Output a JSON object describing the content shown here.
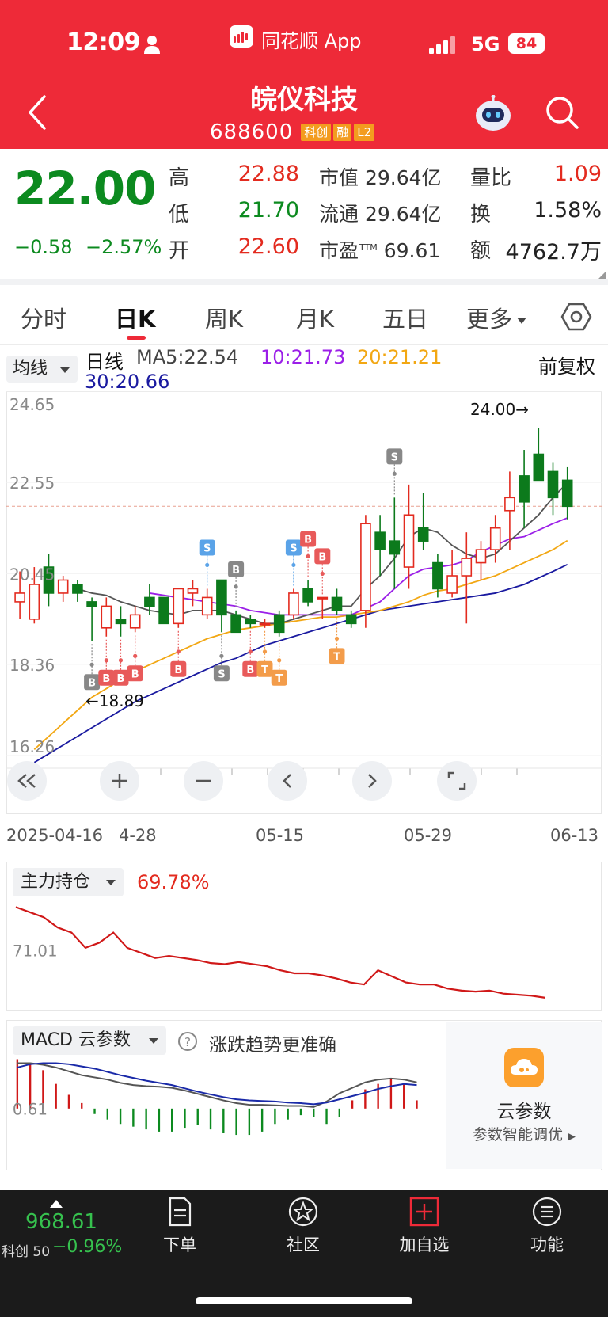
{
  "status_bar": {
    "time": "12:09",
    "network": "5G",
    "battery": "84"
  },
  "app": {
    "name": "同花顺 App"
  },
  "stock": {
    "name": "皖仪科技",
    "code": "688600",
    "tags": [
      "科创",
      "融",
      "L2"
    ]
  },
  "quote": {
    "price": "22.00",
    "change": "−0.58",
    "change_pct": "−2.57%",
    "high_label": "高",
    "high": "22.88",
    "low_label": "低",
    "low": "21.70",
    "open_label": "开",
    "open": "22.60",
    "mcap": "市值 29.64亿",
    "float": "流通 29.64亿",
    "pe_label": "市盈",
    "pe_sup": "TTM",
    "pe_value": "69.61",
    "vol_ratio_label": "量比",
    "vol_ratio": "1.09",
    "turnover_label": "换",
    "turnover": "1.58%",
    "amount_label": "额",
    "amount": "4762.7万"
  },
  "tabs": [
    "分时",
    "日K",
    "周K",
    "月K",
    "五日",
    "更多"
  ],
  "active_tab": "日K",
  "ma_legend": {
    "toggle": "均线",
    "period": "日线",
    "ma5": "MA5:22.54",
    "ma10": "10:21.73",
    "ma20": "20:21.21",
    "ma30": "30:20.66",
    "adjust": "前复权",
    "colors": {
      "ma5": "#555555",
      "ma10": "#9b1fe8",
      "ma20": "#f2a713",
      "ma30": "#1a1aa0"
    }
  },
  "chart_data": {
    "type": "candlestick",
    "y_ticks": [
      "24.65",
      "22.55",
      "20.45",
      "18.36",
      "16.26"
    ],
    "ylim": [
      16.26,
      24.65
    ],
    "x_labels": [
      "2025-04-16",
      "4-28",
      "05-15",
      "05-29",
      "06-13"
    ],
    "last_close_line": 22.0,
    "annotations": {
      "high": "24.00→",
      "low": "←18.89"
    },
    "candles": [
      {
        "o": 19.8,
        "h": 20.5,
        "l": 19.4,
        "c": 20.0
      },
      {
        "o": 19.4,
        "h": 20.6,
        "l": 19.3,
        "c": 20.2
      },
      {
        "o": 20.6,
        "h": 20.9,
        "l": 19.7,
        "c": 20.0
      },
      {
        "o": 20.0,
        "h": 20.4,
        "l": 19.8,
        "c": 20.3
      },
      {
        "o": 20.2,
        "h": 20.3,
        "l": 19.8,
        "c": 20.0
      },
      {
        "o": 19.8,
        "h": 19.9,
        "l": 18.9,
        "c": 19.7
      },
      {
        "o": 19.2,
        "h": 19.9,
        "l": 19.0,
        "c": 19.7
      },
      {
        "o": 19.4,
        "h": 19.7,
        "l": 19.0,
        "c": 19.3
      },
      {
        "o": 19.2,
        "h": 19.7,
        "l": 19.1,
        "c": 19.5
      },
      {
        "o": 19.9,
        "h": 20.2,
        "l": 19.5,
        "c": 19.7
      },
      {
        "o": 19.9,
        "h": 19.9,
        "l": 19.3,
        "c": 19.3
      },
      {
        "o": 19.3,
        "h": 20.1,
        "l": 19.2,
        "c": 20.1
      },
      {
        "o": 20.0,
        "h": 20.3,
        "l": 19.7,
        "c": 20.1
      },
      {
        "o": 19.5,
        "h": 20.1,
        "l": 19.4,
        "c": 19.9
      },
      {
        "o": 20.3,
        "h": 20.3,
        "l": 19.1,
        "c": 19.5
      },
      {
        "o": 19.5,
        "h": 19.6,
        "l": 19.1,
        "c": 19.1
      },
      {
        "o": 19.4,
        "h": 19.5,
        "l": 19.2,
        "c": 19.3
      },
      {
        "o": 19.3,
        "h": 19.4,
        "l": 19.2,
        "c": 19.3
      },
      {
        "o": 19.5,
        "h": 19.6,
        "l": 19.0,
        "c": 19.1
      },
      {
        "o": 19.5,
        "h": 20.1,
        "l": 19.4,
        "c": 20.0
      },
      {
        "o": 20.1,
        "h": 20.3,
        "l": 19.7,
        "c": 19.8
      },
      {
        "o": 19.9,
        "h": 19.9,
        "l": 19.4,
        "c": 19.9
      },
      {
        "o": 19.9,
        "h": 20.1,
        "l": 19.5,
        "c": 19.6
      },
      {
        "o": 19.5,
        "h": 19.6,
        "l": 19.2,
        "c": 19.3
      },
      {
        "o": 19.6,
        "h": 21.8,
        "l": 19.2,
        "c": 21.6
      },
      {
        "o": 21.4,
        "h": 21.8,
        "l": 20.4,
        "c": 21.0
      },
      {
        "o": 21.2,
        "h": 22.2,
        "l": 20.1,
        "c": 20.9
      },
      {
        "o": 20.6,
        "h": 22.5,
        "l": 20.1,
        "c": 21.8
      },
      {
        "o": 21.5,
        "h": 22.3,
        "l": 21.0,
        "c": 21.2
      },
      {
        "o": 20.7,
        "h": 20.9,
        "l": 19.9,
        "c": 20.1
      },
      {
        "o": 20.0,
        "h": 21.0,
        "l": 19.9,
        "c": 20.4
      },
      {
        "o": 20.4,
        "h": 21.4,
        "l": 19.3,
        "c": 20.8
      },
      {
        "o": 20.7,
        "h": 21.2,
        "l": 20.3,
        "c": 21.0
      },
      {
        "o": 21.0,
        "h": 21.8,
        "l": 20.7,
        "c": 21.5
      },
      {
        "o": 21.9,
        "h": 22.8,
        "l": 21.0,
        "c": 22.2
      },
      {
        "o": 22.7,
        "h": 23.3,
        "l": 21.5,
        "c": 22.1
      },
      {
        "o": 23.2,
        "h": 23.8,
        "l": 22.6,
        "c": 22.6
      },
      {
        "o": 22.8,
        "h": 23.0,
        "l": 21.8,
        "c": 22.2
      },
      {
        "o": 22.6,
        "h": 22.9,
        "l": 21.7,
        "c": 22.0
      }
    ],
    "ma5": [
      null,
      null,
      null,
      null,
      20.1,
      20.0,
      19.95,
      19.8,
      19.7,
      19.6,
      19.55,
      19.5,
      19.6,
      19.6,
      19.6,
      19.5,
      19.4,
      19.3,
      19.3,
      19.4,
      19.5,
      19.6,
      19.7,
      19.7,
      20.1,
      20.4,
      20.8,
      21.3,
      21.5,
      21.4,
      21.1,
      20.9,
      20.8,
      20.9,
      21.2,
      21.5,
      21.8,
      22.2,
      22.54
    ],
    "ma10": [
      null,
      null,
      null,
      null,
      null,
      null,
      null,
      null,
      null,
      20.0,
      19.95,
      19.9,
      19.85,
      19.8,
      19.75,
      19.7,
      19.6,
      19.55,
      19.5,
      19.5,
      19.5,
      19.5,
      19.5,
      19.5,
      19.65,
      19.8,
      20.1,
      20.4,
      20.55,
      20.6,
      20.65,
      20.75,
      20.95,
      21.1,
      21.25,
      21.3,
      21.45,
      21.6,
      21.73
    ],
    "ma20": [
      null,
      16.4,
      16.7,
      17.0,
      17.3,
      17.6,
      17.8,
      18.0,
      18.2,
      18.35,
      18.5,
      18.65,
      18.8,
      18.95,
      19.05,
      19.15,
      19.2,
      19.25,
      19.3,
      19.35,
      19.4,
      19.45,
      19.45,
      19.5,
      19.55,
      19.6,
      19.7,
      19.8,
      19.95,
      20.05,
      20.1,
      20.2,
      20.3,
      20.4,
      20.55,
      20.7,
      20.85,
      21.0,
      21.21
    ],
    "ma30": [
      null,
      16.1,
      16.3,
      16.5,
      16.7,
      16.9,
      17.1,
      17.3,
      17.5,
      17.65,
      17.8,
      17.95,
      18.1,
      18.25,
      18.4,
      18.5,
      18.65,
      18.8,
      18.9,
      19.0,
      19.1,
      19.2,
      19.3,
      19.4,
      19.5,
      19.6,
      19.65,
      19.7,
      19.75,
      19.8,
      19.85,
      19.9,
      19.95,
      20.0,
      20.1,
      20.2,
      20.35,
      20.5,
      20.66
    ],
    "markers": [
      {
        "i": 5,
        "t": "B",
        "side": "below",
        "color": "#888888"
      },
      {
        "i": 6,
        "t": "B",
        "side": "below",
        "color": "#e85a5a"
      },
      {
        "i": 7,
        "t": "B",
        "side": "below",
        "color": "#e85a5a"
      },
      {
        "i": 8,
        "t": "B",
        "side": "below",
        "color": "#e85a5a"
      },
      {
        "i": 11,
        "t": "B",
        "side": "below",
        "color": "#e85a5a"
      },
      {
        "i": 13,
        "t": "S",
        "side": "above",
        "color": "#5aa3e8"
      },
      {
        "i": 14,
        "t": "S",
        "side": "below",
        "color": "#888888"
      },
      {
        "i": 15,
        "t": "B",
        "side": "above",
        "color": "#888888"
      },
      {
        "i": 16,
        "t": "B",
        "side": "below",
        "color": "#e85a5a"
      },
      {
        "i": 17,
        "t": "T",
        "side": "below",
        "color": "#f39c4a"
      },
      {
        "i": 18,
        "t": "T",
        "side": "below",
        "color": "#f39c4a"
      },
      {
        "i": 19,
        "t": "S",
        "side": "above",
        "color": "#5aa3e8"
      },
      {
        "i": 20,
        "t": "B",
        "side": "above",
        "color": "#e85a5a"
      },
      {
        "i": 21,
        "t": "B",
        "side": "above",
        "color": "#e85a5a"
      },
      {
        "i": 22,
        "t": "T",
        "side": "below",
        "color": "#f39c4a"
      },
      {
        "i": 26,
        "t": "S",
        "side": "above",
        "color": "#888888"
      }
    ]
  },
  "chart_controls": [
    "collapse",
    "zoom-in",
    "zoom-out",
    "prev",
    "next",
    "fullscreen"
  ],
  "holding": {
    "toggle": "主力持仓",
    "value": "69.78%",
    "axis_label": "71.01",
    "line_color": "#d01818",
    "series": [
      0.1,
      0.15,
      0.2,
      0.3,
      0.35,
      0.5,
      0.45,
      0.35,
      0.5,
      0.55,
      0.6,
      0.58,
      0.6,
      0.62,
      0.65,
      0.66,
      0.64,
      0.66,
      0.68,
      0.72,
      0.75,
      0.75,
      0.77,
      0.8,
      0.84,
      0.86,
      0.72,
      0.78,
      0.84,
      0.86,
      0.86,
      0.9,
      0.92,
      0.93,
      0.92,
      0.95,
      0.96,
      0.97,
      0.99
    ]
  },
  "macd": {
    "toggle": "MACD 云参数",
    "hint": "涨跌趋势更准确",
    "axis_label": "0.61",
    "dif": [
      0.2,
      0.2,
      0.23,
      0.28,
      0.35,
      0.42,
      0.46,
      0.5,
      0.56,
      0.6,
      0.62,
      0.63,
      0.65,
      0.7,
      0.76,
      0.82,
      0.88,
      0.93,
      0.96,
      0.96,
      0.97,
      0.98,
      0.98,
      1.0,
      0.9,
      0.75,
      0.65,
      0.55,
      0.5,
      0.48,
      0.5,
      0.55
    ],
    "dea": [
      0.28,
      0.22,
      0.2,
      0.2,
      0.22,
      0.26,
      0.3,
      0.36,
      0.42,
      0.47,
      0.52,
      0.56,
      0.6,
      0.66,
      0.72,
      0.77,
      0.82,
      0.86,
      0.88,
      0.89,
      0.9,
      0.92,
      0.93,
      0.95,
      0.92,
      0.86,
      0.8,
      0.74,
      0.67,
      0.62,
      0.58,
      0.6
    ],
    "hist": [
      0.9,
      0.8,
      0.7,
      0.45,
      0.25,
      0.1,
      -0.1,
      -0.2,
      -0.28,
      -0.33,
      -0.38,
      -0.42,
      -0.42,
      -0.35,
      -0.3,
      -0.38,
      -0.45,
      -0.48,
      -0.48,
      -0.42,
      -0.28,
      -0.2,
      -0.12,
      -0.15,
      -0.28,
      -0.15,
      0.15,
      0.35,
      0.45,
      0.55,
      0.45,
      0.15
    ]
  },
  "cloud": {
    "title": "云参数",
    "subtitle": "参数智能调优"
  },
  "bottom_index": {
    "value": "968.61",
    "name": "科创 50",
    "change": "−0.96%"
  },
  "bottom_nav": [
    {
      "label": "下单",
      "icon": "document-icon"
    },
    {
      "label": "社区",
      "icon": "community-icon"
    },
    {
      "label": "加自选",
      "icon": "add-watchlist-icon"
    },
    {
      "label": "功能",
      "icon": "menu-icon"
    }
  ]
}
